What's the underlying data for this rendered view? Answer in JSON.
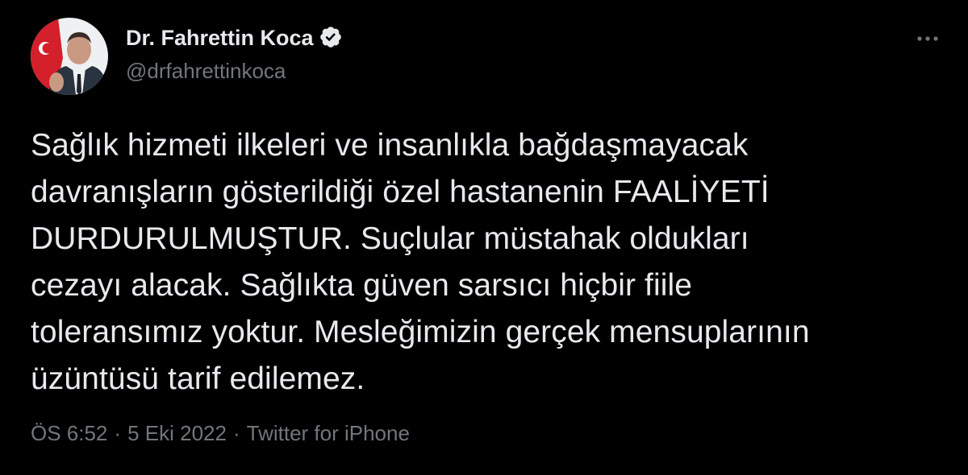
{
  "author": {
    "name": "Dr. Fahrettin Koca",
    "handle": "@drfahrettinkoca",
    "verified": true
  },
  "tweet": {
    "lines": [
      "Sağlık hizmeti ilkeleri ve insanlıkla bağdaşmayacak",
      "davranışların gösterildiği özel hastanenin FAALİYETİ",
      "DURDURULMUŞTUR. Suçlular müstahak oldukları",
      "cezayı alacak. Sağlıkta güven sarsıcı hiçbir fiile",
      "toleransımız yoktur. Mesleğimizin gerçek mensuplarının",
      "üzüntüsü tarif edilemez."
    ]
  },
  "meta": {
    "time": "ÖS 6:52",
    "date": "5 Eki 2022",
    "source": "Twitter for iPhone",
    "separator": "·"
  },
  "colors": {
    "background": "#000000",
    "text": "#e7e9ea",
    "secondary": "#71767b"
  },
  "icons": {
    "verified": "verified-badge-icon",
    "more": "more-options-icon"
  }
}
